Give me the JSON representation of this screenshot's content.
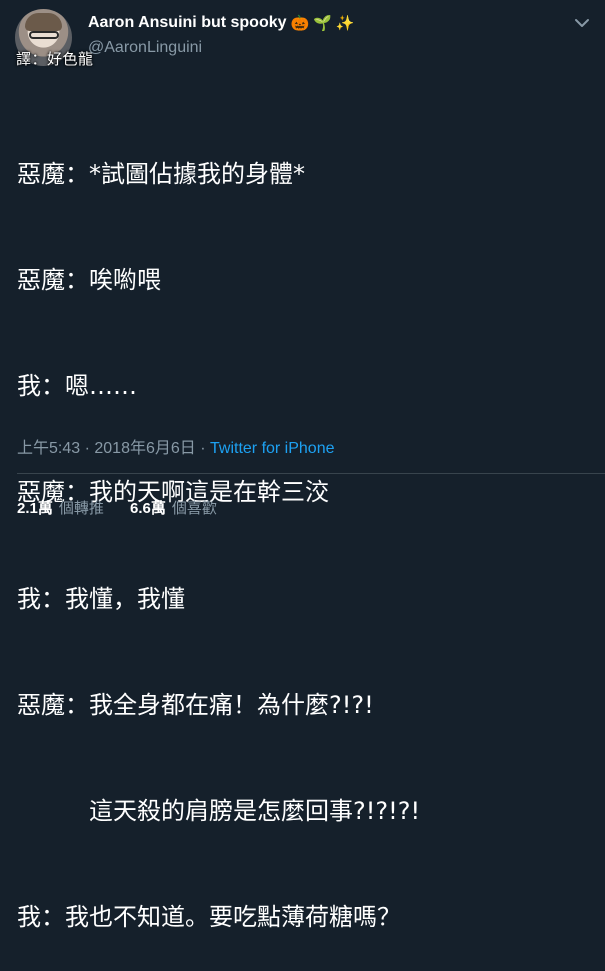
{
  "author": {
    "display_name": "Aaron Ansuini but spooky",
    "emojis": [
      "🎃",
      "🌱",
      "✨"
    ],
    "handle": "@AaronLinguini",
    "translator_note": "譯：好色龍"
  },
  "tweet": {
    "lines": [
      "惡魔：*試圖佔據我的身體*",
      "惡魔：唉喲喂",
      "我：嗯……",
      "惡魔：我的天啊這是在幹三洨",
      "我：我懂，我懂",
      "惡魔：我全身都在痛！為什麼?!?!",
      "　　　這天殺的肩膀是怎麼回事?!?!?!",
      "我：我也不知道。要吃點薄荷糖嗎？"
    ]
  },
  "meta": {
    "time": "上午5:43",
    "separator": " · ",
    "date": "2018年6月6日",
    "source": "Twitter for iPhone"
  },
  "stats": {
    "retweets": {
      "count": "2.1萬",
      "label": "個轉推"
    },
    "likes": {
      "count": "6.6萬",
      "label": "個喜歡"
    }
  },
  "colors": {
    "background": "#15202b",
    "text": "#ffffff",
    "secondary": "#8899a6",
    "link": "#1da1f2",
    "divider": "#38444d"
  }
}
